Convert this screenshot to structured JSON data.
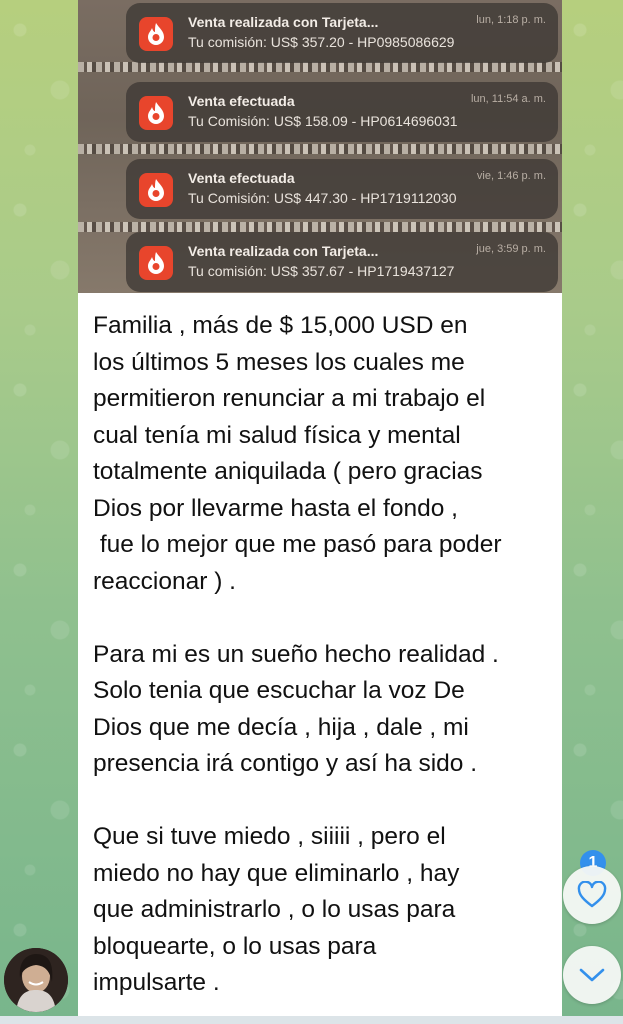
{
  "notifications": [
    {
      "title": "Venta realizada con Tarjeta...",
      "time": "lun, 1:18 p. m.",
      "body": "Tu comisión: US$ 357.20 - HP0985086629"
    },
    {
      "title": "Venta efectuada",
      "time": "lun, 11:54 a. m.",
      "body": "Tu Comisión: US$ 158.09 - HP0614696031"
    },
    {
      "title": "Venta efectuada",
      "time": "vie, 1:46 p. m.",
      "body": "Tu Comisión: US$ 447.30 - HP1719112030"
    },
    {
      "title": "Venta realizada con Tarjeta...",
      "time": "jue, 3:59 p. m.",
      "body": "Tu comisión: US$ 357.67 - HP1719437127"
    }
  ],
  "message": {
    "text": "Familia , más de $ 15,000 USD en\nlos últimos 5 meses los cuales me\npermitieron renunciar a mi trabajo el\ncual tenía mi salud física y mental\ntotalmente aniquilada ( pero gracias\nDios por llevarme hasta el fondo ,\n fue lo mejor que me pasó para poder\nreaccionar ) .\n\nPara mi es un sueño hecho realidad .\nSolo tenia que escuchar la voz De\nDios que me decía , hija , dale , mi\npresencia irá contigo y así ha sido .\n\nQue si tuve miedo , siiiii , pero el\nmiedo no hay que eliminarlo , hay\nque administrarlo , o lo usas para\nbloquearte, o lo usas para\nimpulsarte ."
  },
  "reactions": {
    "unread_count": "1"
  },
  "icons": {
    "app": "flame-app-icon",
    "reaction": "heart-icon",
    "scroll": "chevron-down-icon"
  },
  "colors": {
    "accent": "#3390ec",
    "app_icon": "#e8452c"
  }
}
